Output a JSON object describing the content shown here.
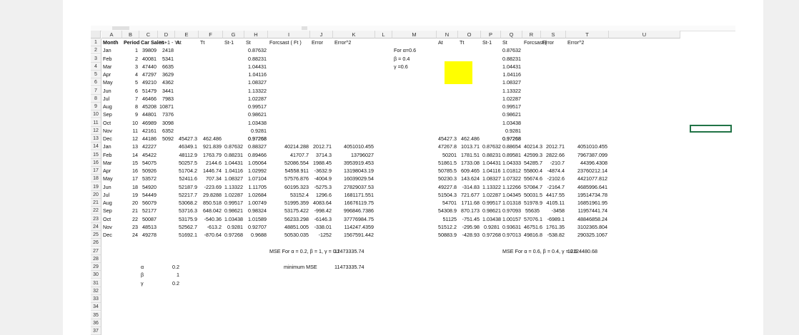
{
  "sheet": {
    "columns": [
      "A",
      "B",
      "C",
      "D",
      "E",
      "F",
      "G",
      "H",
      "I",
      "J",
      "K",
      "L",
      "M",
      "N",
      "O",
      "P",
      "Q",
      "R",
      "S",
      "T",
      "U"
    ],
    "header_row": {
      "A": "Month",
      "B": "Period",
      "C": "Car Sales",
      "D": "Yt+1 - Yt",
      "E": "At",
      "F": "Tt",
      "G": "St-1",
      "H": "St",
      "I": "Forcsast ( Ft )",
      "J": "Error",
      "K": "Error^2",
      "N": "At",
      "O": "Tt",
      "P": "St-1",
      "Q": "St",
      "R": "Forcsast (",
      "S": "Error",
      "T": "Error^2"
    },
    "params_note": [
      "For α=0.6",
      "β = 0.4",
      "γ =0.6"
    ],
    "months": [
      "Jan",
      "Feb",
      "Mar",
      "Apr",
      "May",
      "Jun",
      "Jul",
      "Aug",
      "Sep",
      "Oct",
      "Nov",
      "Dec",
      "Jan",
      "Feb",
      "Mar",
      "Apr",
      "May",
      "Jun",
      "Jul",
      "Aug",
      "Sep",
      "Oct",
      "Nov",
      "Dec"
    ],
    "periods": [
      "1",
      "2",
      "3",
      "4",
      "5",
      "6",
      "7",
      "8",
      "9",
      "10",
      "11",
      "12",
      "13",
      "14",
      "15",
      "16",
      "17",
      "18",
      "19",
      "20",
      "21",
      "22",
      "23",
      "24"
    ],
    "car_sales": [
      "39809",
      "40081",
      "47440",
      "47297",
      "49210",
      "51479",
      "46466",
      "45208",
      "44801",
      "46989",
      "42161",
      "44186",
      "42227",
      "45422",
      "54075",
      "50926",
      "53572",
      "54920",
      "54449",
      "56079",
      "52177",
      "50087",
      "48513",
      "49278"
    ],
    "diff": [
      "2418",
      "5341",
      "6635",
      "3629",
      "4362",
      "3441",
      "7983",
      "10871",
      "7376",
      "3098",
      "6352",
      "5092"
    ],
    "seasonal_init": [
      "0.87632",
      "0.88231",
      "1.04431",
      "1.04116",
      "1.08327",
      "1.13322",
      "1.02287",
      "0.99517",
      "0.98621",
      "1.03438",
      "0.9281",
      "0.97268"
    ],
    "model1": [
      [
        "45427.3",
        "462.486",
        "",
        "0.97268",
        "",
        "",
        ""
      ],
      [
        "46349.1",
        "921.839",
        "0.87632",
        "0.88327",
        "40214.288",
        "2012.71",
        "4051010.455"
      ],
      [
        "48112.9",
        "1763.79",
        "0.88231",
        "0.89466",
        "41707.7",
        "3714.3",
        "13796027"
      ],
      [
        "50257.5",
        "2144.6",
        "1.04431",
        "1.05064",
        "52086.554",
        "1988.45",
        "3953919.453"
      ],
      [
        "51704.2",
        "1446.74",
        "1.04116",
        "1.02992",
        "54558.911",
        "-3632.9",
        "13198043.19"
      ],
      [
        "52411.6",
        "707.34",
        "1.08327",
        "1.07104",
        "57576.876",
        "-4004.9",
        "16039029.54"
      ],
      [
        "52187.9",
        "-223.69",
        "1.13322",
        "1.11705",
        "60195.323",
        "-5275.3",
        "27829037.53"
      ],
      [
        "52217.7",
        "29.8288",
        "1.02287",
        "1.02684",
        "53152.4",
        "1296.6",
        "1681171.551"
      ],
      [
        "53068.2",
        "850.518",
        "0.99517",
        "1.00749",
        "51995.359",
        "4083.64",
        "16676119.75"
      ],
      [
        "53716.3",
        "648.042",
        "0.98621",
        "0.98324",
        "53175.422",
        "-998.42",
        "996846.7386"
      ],
      [
        "53175.9",
        "-540.36",
        "1.03438",
        "1.01589",
        "56233.298",
        "-6146.3",
        "37776984.75"
      ],
      [
        "52562.7",
        "-613.2",
        "0.9281",
        "0.92707",
        "48851.005",
        "-338.01",
        "114247.4359"
      ],
      [
        "51692.1",
        "-870.64",
        "0.97268",
        "0.9688",
        "50530.035",
        "-1252",
        "1567591.442"
      ]
    ],
    "model2": [
      [
        "45427.3",
        "462.486",
        "",
        "0.97268",
        "",
        "",
        ""
      ],
      [
        "47267.8",
        "1013.71",
        "0.87632",
        "0.88654",
        "40214.3",
        "2012.71",
        "4051010.455"
      ],
      [
        "50201",
        "1781.51",
        "0.88231",
        "0.89581",
        "42599.3",
        "2822.66",
        "7967387.099"
      ],
      [
        "51861.5",
        "1733.08",
        "1.04431",
        "1.04333",
        "54285.7",
        "-210.7",
        "44396.4308"
      ],
      [
        "50785.5",
        "609.465",
        "1.04116",
        "1.01812",
        "55800.4",
        "-4874.4",
        "23760212.14"
      ],
      [
        "50230.3",
        "143.624",
        "1.08327",
        "1.07322",
        "55674.6",
        "-2102.6",
        "4421077.812"
      ],
      [
        "49227.8",
        "-314.83",
        "1.13322",
        "1.12266",
        "57084.7",
        "-2164.7",
        "4685996.641"
      ],
      [
        "51504.3",
        "721.677",
        "1.02287",
        "1.04345",
        "50031.5",
        "4417.55",
        "19514734.78"
      ],
      [
        "54701",
        "1711.68",
        "0.99517",
        "1.01318",
        "51978.9",
        "4105.11",
        "16851961.95"
      ],
      [
        "54308.9",
        "870.173",
        "0.98621",
        "0.97093",
        "55635",
        "-3458",
        "11957441.74"
      ],
      [
        "51125",
        "-751.45",
        "1.03438",
        "1.00157",
        "57076.1",
        "-6989.1",
        "48846858.24"
      ],
      [
        "51512.2",
        "-295.98",
        "0.9281",
        "0.93631",
        "46751.6",
        "1761.35",
        "3102365.804"
      ],
      [
        "50883.9",
        "-428.93",
        "0.97268",
        "0.97013",
        "49816.8",
        "-538.82",
        "290325.1067"
      ]
    ],
    "mse1_label": "MSE For α = 0.2, β = 1, γ = 0.2",
    "mse1_value": "11473335.74",
    "mse2_label": "MSE For α = 0.6, β = 0.4, γ = 0.6",
    "mse2_value": "12124480.68",
    "min_label": "minimum MSE",
    "min_value": "11473335.74",
    "alpha_label": "α",
    "alpha_value": "0.2",
    "beta_label": "β",
    "beta_value": "1",
    "gamma_label": "γ",
    "gamma_value": "0.2"
  },
  "colors": {
    "highlight": "#ffff00",
    "selection": "#217346"
  }
}
